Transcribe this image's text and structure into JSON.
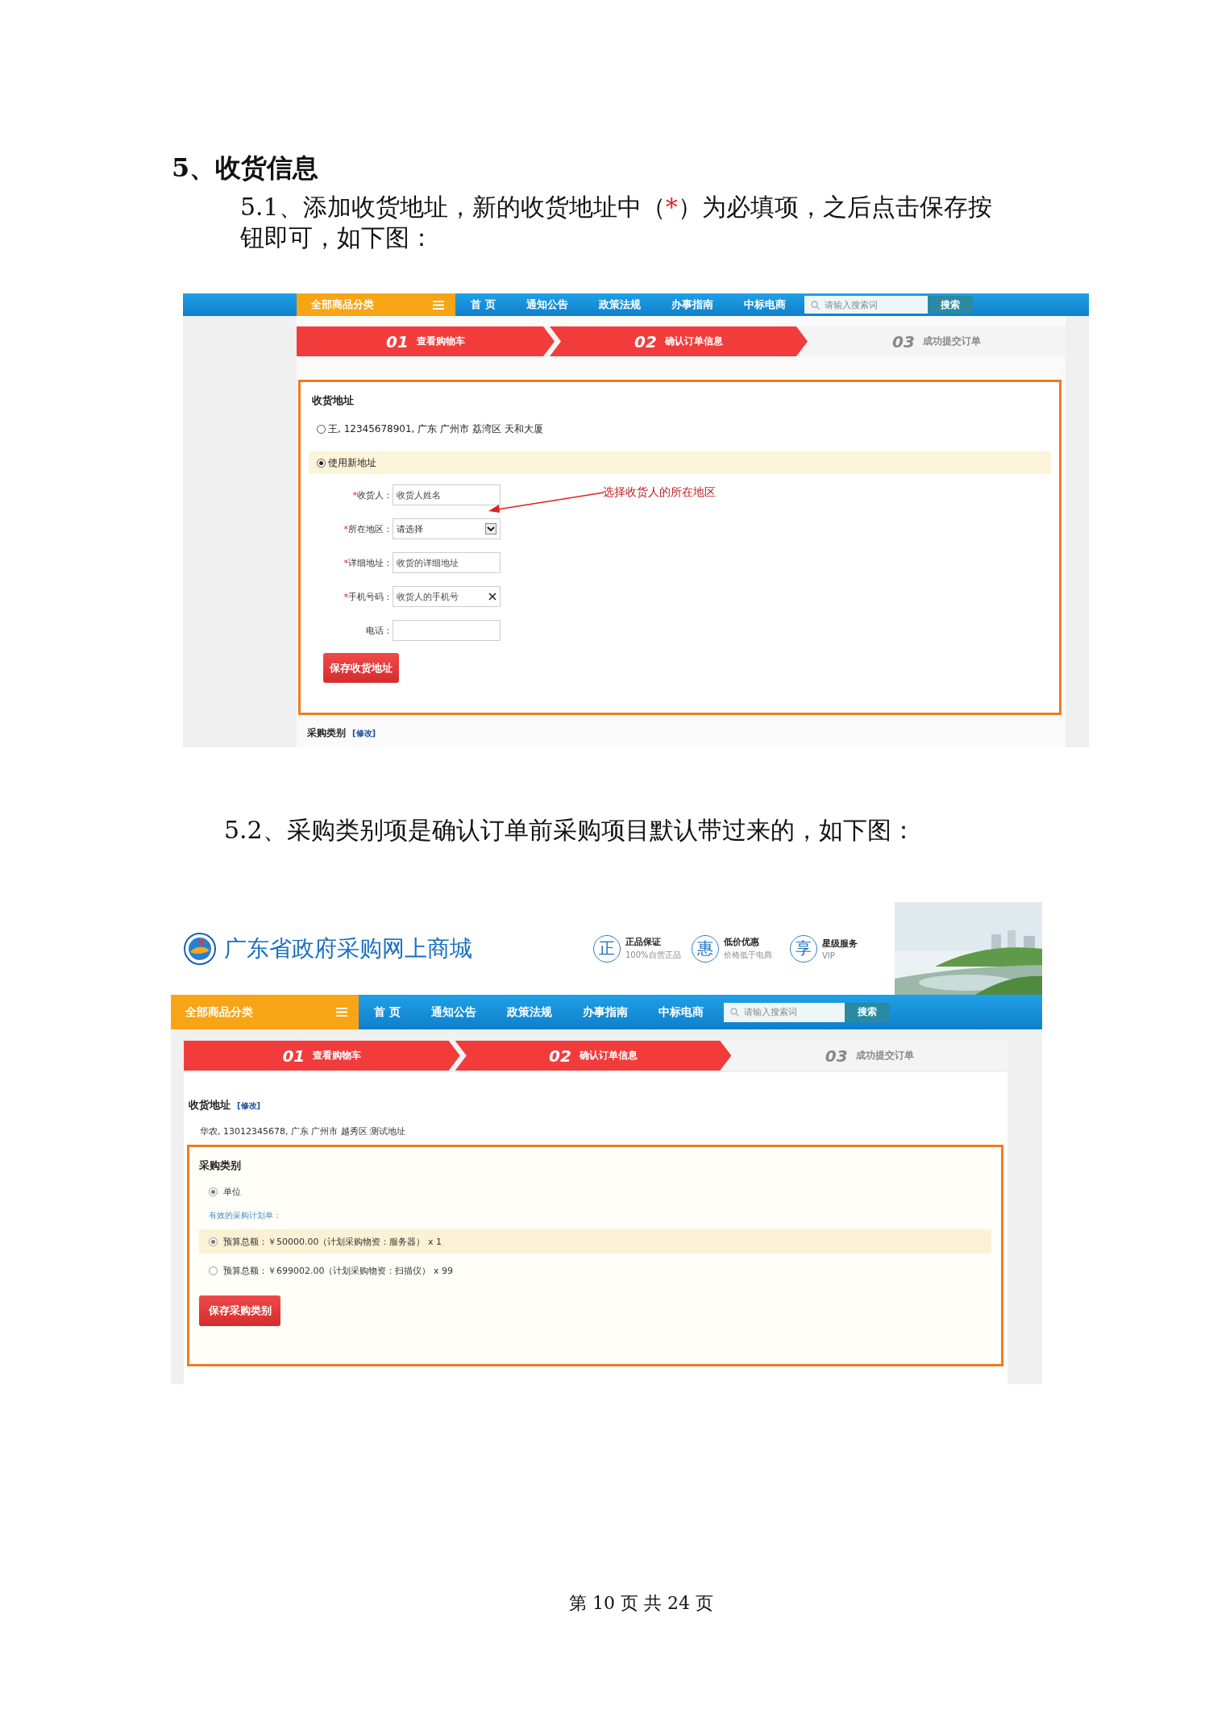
{
  "heading": "5、收货信息",
  "step_1": {
    "segments": [
      {
        "kind": "text",
        "text": "5.1、添加收货地址，新的收货地址中（"
      },
      {
        "kind": "mark",
        "text": "*"
      },
      {
        "kind": "text",
        "text": "）为必填项，之后点击保存按钮即可，如下图："
      }
    ]
  },
  "screenshot_1": {
    "nav": {
      "category": "全部商品分类",
      "items": [
        "首 页",
        "通知公告",
        "政策法规",
        "办事指南",
        "中标电商"
      ],
      "search": {
        "placeholder": "请输入搜索词"
      },
      "search_button": "搜索"
    },
    "steps": [
      {
        "number": "01",
        "label": "查看购物车",
        "done": true
      },
      {
        "number": "02",
        "label": "确认订单信息",
        "done": true
      },
      {
        "number": "03",
        "label": "成功提交订单",
        "done": false
      }
    ],
    "address": {
      "title": "收货地址",
      "options": [
        {
          "label": "王, 12345678901, 广东 广州市 荔湾区 天和大厦",
          "selected": false
        },
        {
          "label": "使用新地址",
          "selected": true
        }
      ],
      "fields": [
        {
          "mark": "*",
          "label": "收货人：",
          "kind": "text",
          "placeholder": "收货人姓名"
        },
        {
          "mark": "*",
          "label": "所在地区：",
          "kind": "select",
          "value": "请选择"
        },
        {
          "mark": "*",
          "label": "详细地址：",
          "kind": "text",
          "placeholder": "收货的详细地址"
        },
        {
          "mark": "*",
          "label": "手机号码：",
          "kind": "clearable",
          "placeholder": "收货人的手机号"
        },
        {
          "label": "电话：",
          "kind": "text"
        }
      ],
      "save_button": "保存收货地址"
    },
    "callout": "选择收货人的所在地区",
    "next_section": {
      "title": "采购类别",
      "edit_link": "[修改]"
    }
  },
  "step_2": "5.2、采购类别项是确认订单前采购项目默认带过来的，如下图：",
  "screenshot_2": {
    "site_title": "广东省政府采购网上商城",
    "badges": [
      {
        "icon": "正",
        "title": "正品保证",
        "subtitle": "100%自营正品"
      },
      {
        "icon": "惠",
        "title": "低价优惠",
        "subtitle": "价格低于电商"
      },
      {
        "icon": "享",
        "title": "星级服务",
        "subtitle": "VIP"
      }
    ],
    "nav": {
      "category": "全部商品分类",
      "items": [
        "首 页",
        "通知公告",
        "政策法规",
        "办事指南",
        "中标电商"
      ],
      "search": {
        "placeholder": "请输入搜索词"
      },
      "search_button": "搜索"
    },
    "steps": [
      {
        "number": "01",
        "label": "查看购物车",
        "done": true
      },
      {
        "number": "02",
        "label": "确认订单信息",
        "done": true
      },
      {
        "number": "03",
        "label": "成功提交订单",
        "done": false
      }
    ],
    "address": {
      "title": "收货地址",
      "edit_link": "[修改]",
      "line": "华农, 13012345678, 广东 广州市 越秀区 测试地址"
    },
    "category": {
      "title": "采购类别",
      "options": [
        {
          "label": "单位",
          "selected": true
        }
      ],
      "hint": "有效的采购计划单：",
      "plans": [
        {
          "label": "预算总额：￥50000.00（计划采购物资：服务器） x 1",
          "selected": true
        },
        {
          "label": "预算总额：￥699002.00（计划采购物资：扫描仪） x 99",
          "selected": false
        }
      ],
      "save_button": "保存采购类别"
    }
  },
  "footer": "第 10 页 共 24 页"
}
